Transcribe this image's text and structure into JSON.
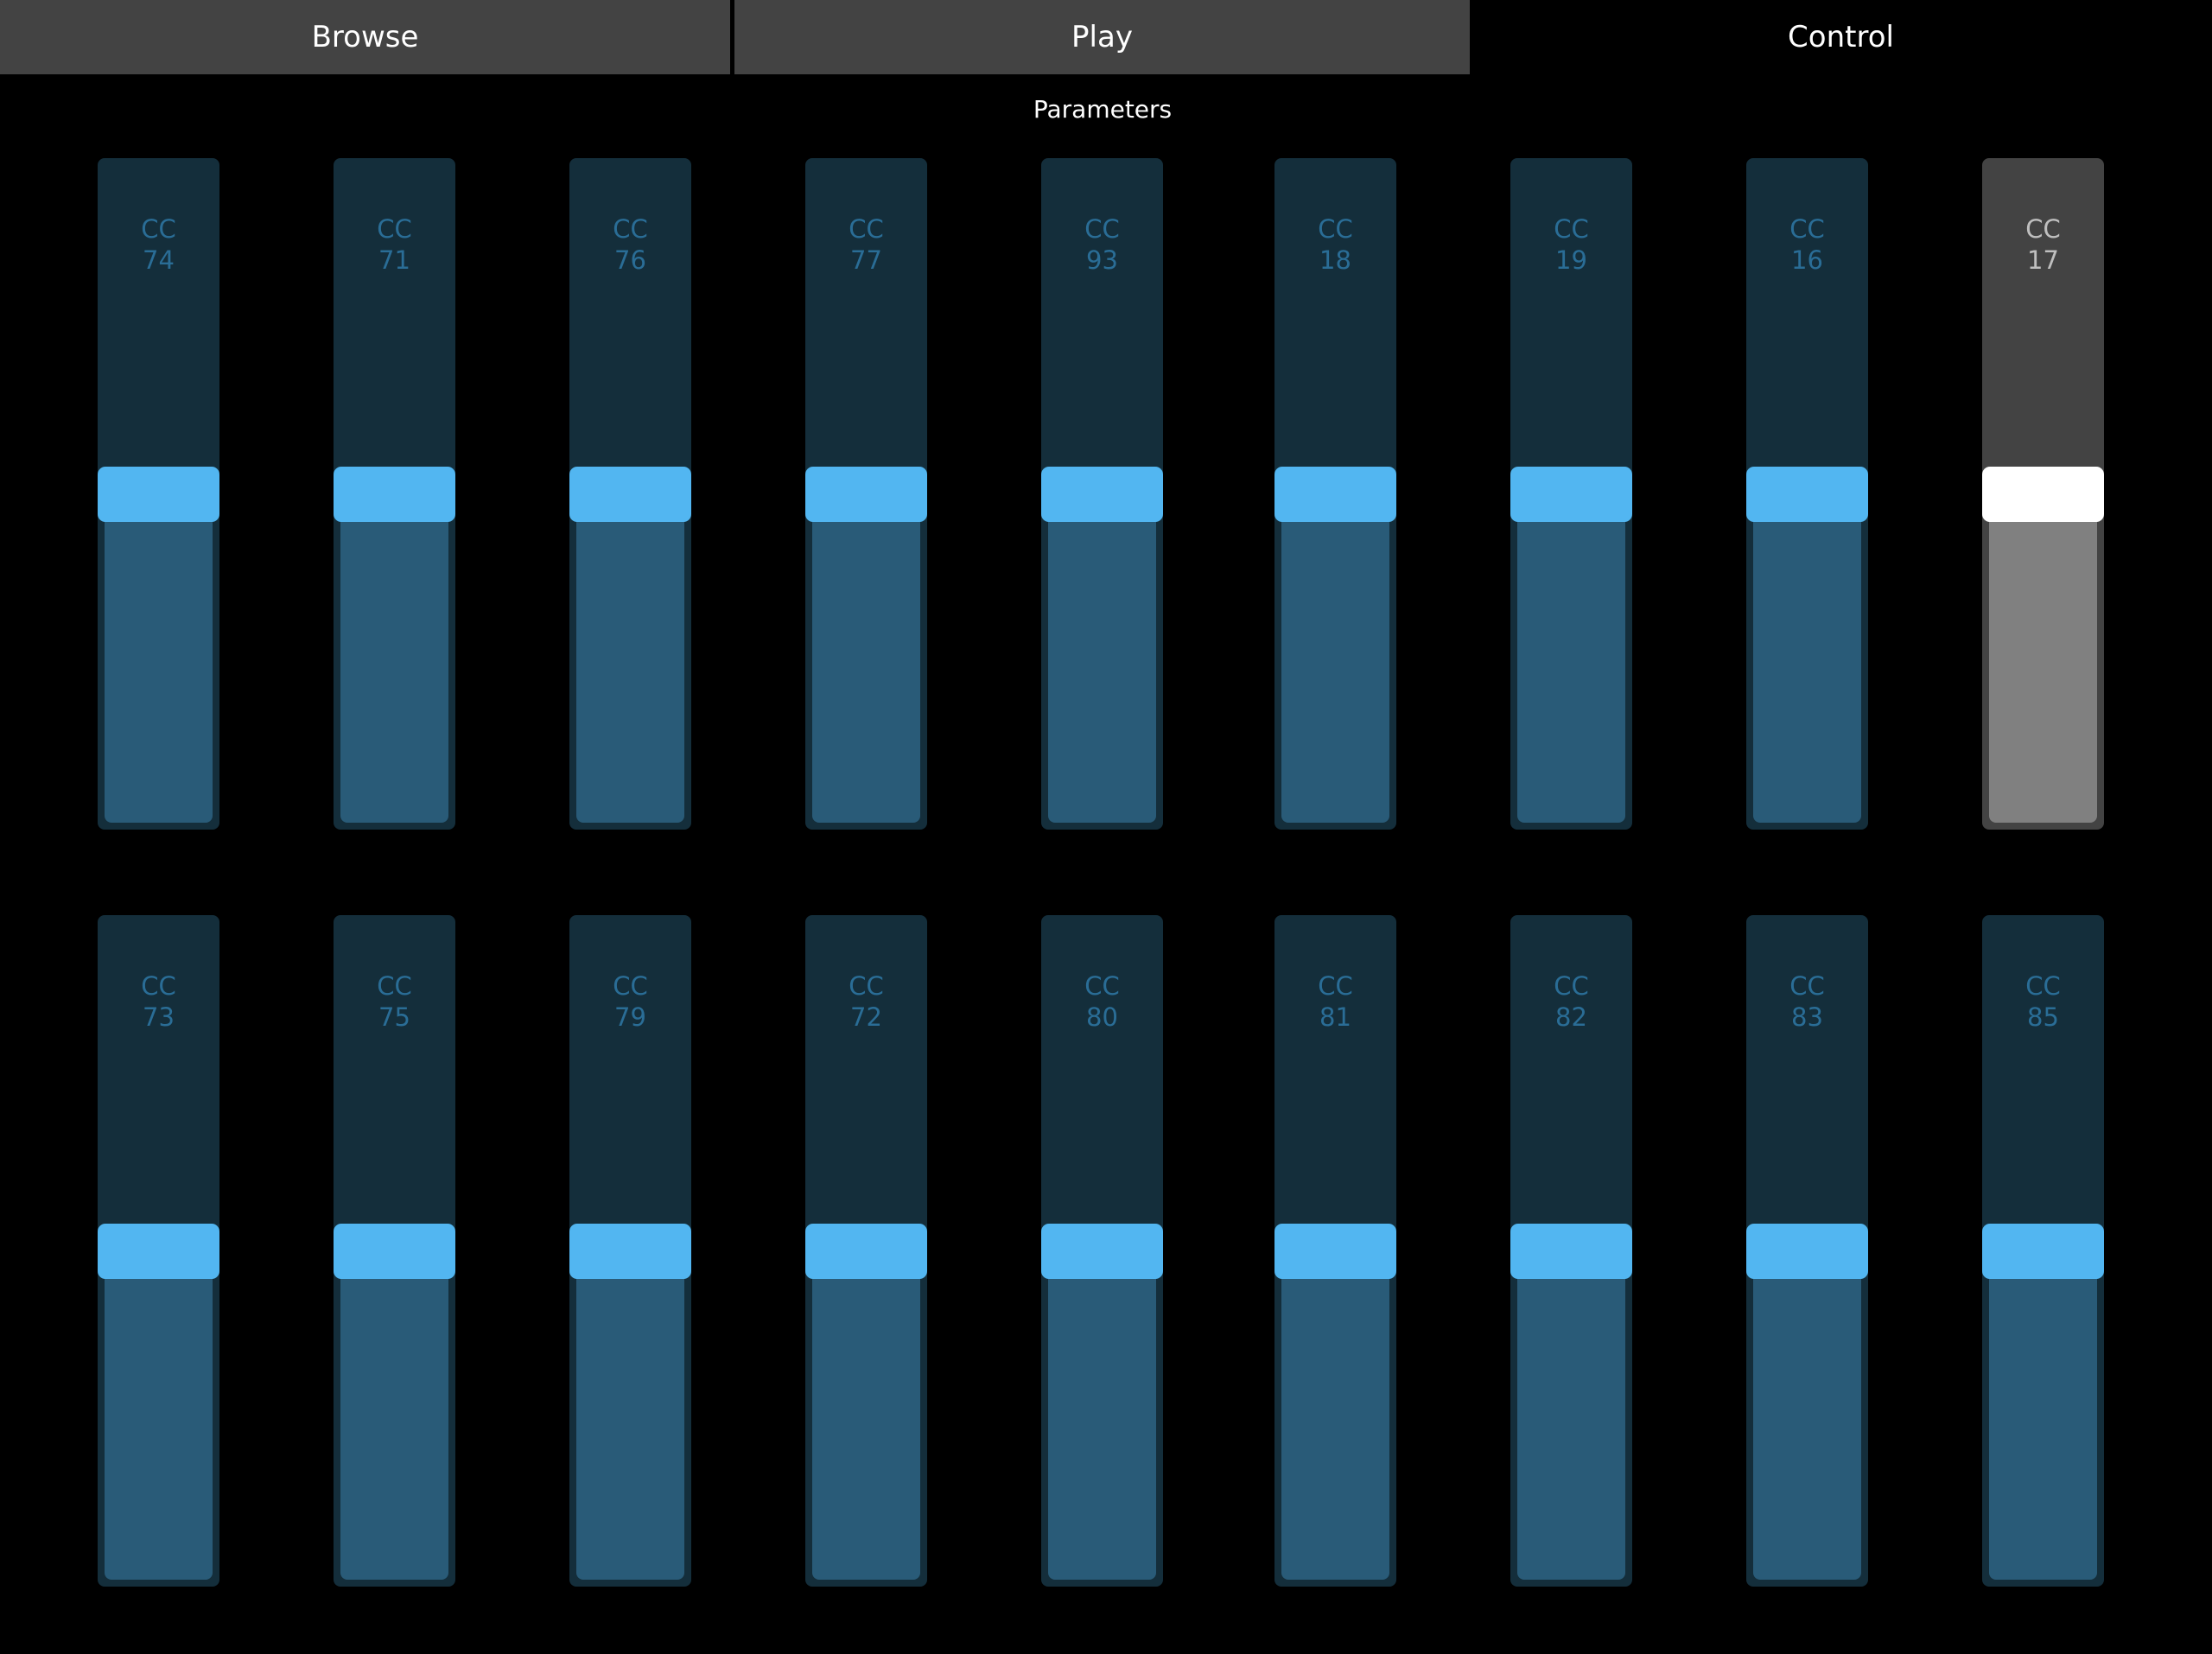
{
  "tabs": [
    {
      "id": "browse",
      "label": "Browse",
      "active": false
    },
    {
      "id": "play",
      "label": "Play",
      "active": false
    },
    {
      "id": "control",
      "label": "Control",
      "active": true
    }
  ],
  "section": {
    "title": "Parameters"
  },
  "colors": {
    "background": "#000000",
    "tab_inactive": "#434343",
    "track": "#142e3b",
    "fill": "#295b78",
    "knob": "#52b6f1",
    "label": "#2a6d96",
    "selected_track": "#434343",
    "selected_fill": "#808080",
    "selected_knob": "#ffffff",
    "selected_label": "#bfbfbf"
  },
  "rows": [
    {
      "sliders": [
        {
          "prefix": "CC",
          "number": "74",
          "value": 0.5,
          "selected": false
        },
        {
          "prefix": "CC",
          "number": "71",
          "value": 0.5,
          "selected": false
        },
        {
          "prefix": "CC",
          "number": "76",
          "value": 0.5,
          "selected": false
        },
        {
          "prefix": "CC",
          "number": "77",
          "value": 0.5,
          "selected": false
        },
        {
          "prefix": "CC",
          "number": "93",
          "value": 0.5,
          "selected": false
        },
        {
          "prefix": "CC",
          "number": "18",
          "value": 0.5,
          "selected": false
        },
        {
          "prefix": "CC",
          "number": "19",
          "value": 0.5,
          "selected": false
        },
        {
          "prefix": "CC",
          "number": "16",
          "value": 0.5,
          "selected": false
        },
        {
          "prefix": "CC",
          "number": "17",
          "value": 0.5,
          "selected": true
        }
      ]
    },
    {
      "sliders": [
        {
          "prefix": "CC",
          "number": "73",
          "value": 0.5,
          "selected": false
        },
        {
          "prefix": "CC",
          "number": "75",
          "value": 0.5,
          "selected": false
        },
        {
          "prefix": "CC",
          "number": "79",
          "value": 0.5,
          "selected": false
        },
        {
          "prefix": "CC",
          "number": "72",
          "value": 0.5,
          "selected": false
        },
        {
          "prefix": "CC",
          "number": "80",
          "value": 0.5,
          "selected": false
        },
        {
          "prefix": "CC",
          "number": "81",
          "value": 0.5,
          "selected": false
        },
        {
          "prefix": "CC",
          "number": "82",
          "value": 0.5,
          "selected": false
        },
        {
          "prefix": "CC",
          "number": "83",
          "value": 0.5,
          "selected": false
        },
        {
          "prefix": "CC",
          "number": "85",
          "value": 0.5,
          "selected": false
        }
      ]
    }
  ]
}
